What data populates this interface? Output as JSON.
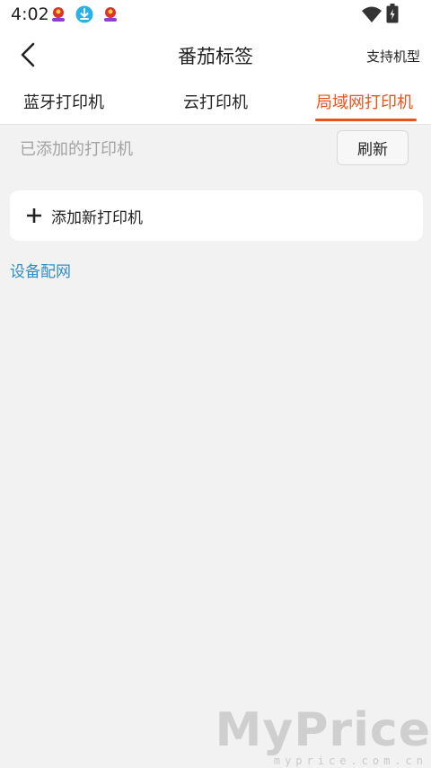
{
  "status_bar": {
    "time": "4:02",
    "icons": [
      "notification-app-icon",
      "download-icon",
      "notification-app-icon"
    ],
    "right_icons": [
      "wifi-icon",
      "battery-icon"
    ]
  },
  "header": {
    "title": "番茄标签",
    "support_label": "支持机型"
  },
  "tabs": [
    {
      "label": "蓝牙打印机",
      "active": false
    },
    {
      "label": "云打印机",
      "active": false
    },
    {
      "label": "局域网打印机",
      "active": true
    }
  ],
  "content": {
    "added_label": "已添加的打印机",
    "refresh_label": "刷新",
    "add_label": "添加新打印机",
    "config_label": "设备配网"
  },
  "watermark": {
    "main": "MyPrice",
    "sub": "myprice.com.cn"
  },
  "colors": {
    "accent": "#e8541c",
    "link": "#2f8ec5",
    "background": "#f2f2f2"
  }
}
